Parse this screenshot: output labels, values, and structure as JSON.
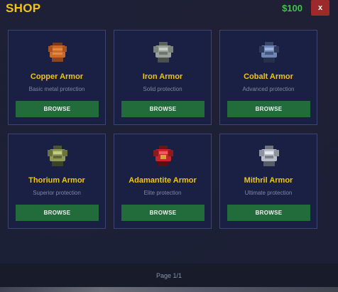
{
  "header": {
    "title": "SHOP",
    "money": "$100",
    "close_label": "x"
  },
  "items": [
    {
      "name": "Copper Armor",
      "desc": "Basic metal protection",
      "button": "BROWSE",
      "icon": "copper-armor-icon",
      "color": "#c96a2a"
    },
    {
      "name": "Iron Armor",
      "desc": "Solid protection",
      "button": "BROWSE",
      "icon": "iron-armor-icon",
      "color": "#9aa09a"
    },
    {
      "name": "Cobalt Armor",
      "desc": "Advanced protection",
      "button": "BROWSE",
      "icon": "cobalt-armor-icon",
      "color": "#6f86b4"
    },
    {
      "name": "Thorium Armor",
      "desc": "Superior protection",
      "button": "BROWSE",
      "icon": "thorium-armor-icon",
      "color": "#8f9a56"
    },
    {
      "name": "Adamantite Armor",
      "desc": "Elite protection",
      "button": "BROWSE",
      "icon": "adamantite-armor-icon",
      "color": "#c3252b"
    },
    {
      "name": "Mithril Armor",
      "desc": "Ultimate protection",
      "button": "BROWSE",
      "icon": "mithril-armor-icon",
      "color": "#b8bcc6"
    }
  ],
  "footer": {
    "page": "Page 1/1"
  }
}
